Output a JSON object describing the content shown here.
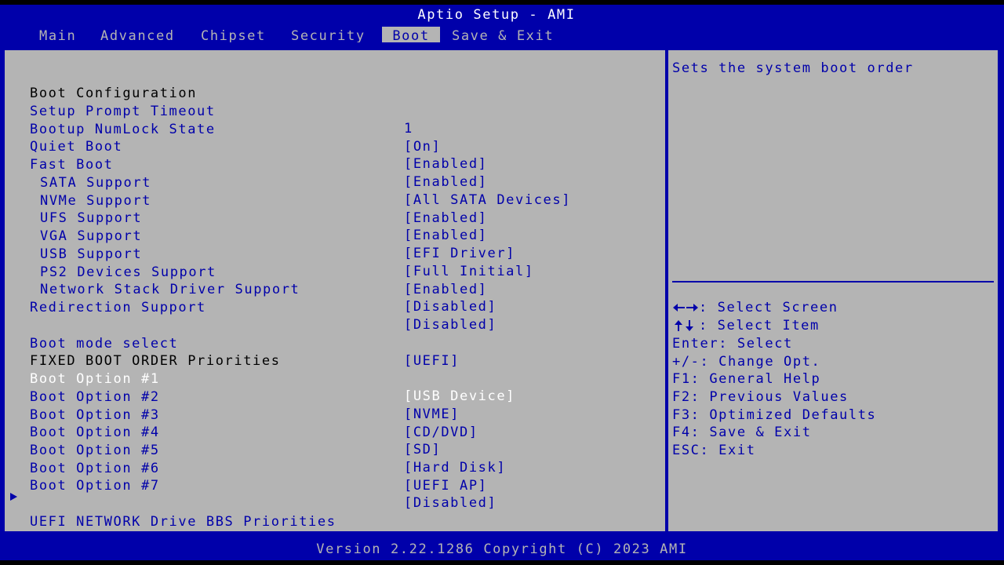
{
  "app": {
    "title": "Aptio Setup - AMI"
  },
  "tabs": [
    {
      "label": "Main"
    },
    {
      "label": "Advanced"
    },
    {
      "label": "Chipset"
    },
    {
      "label": "Security"
    },
    {
      "label": "Boot",
      "active": true
    },
    {
      "label": "Save & Exit"
    }
  ],
  "boot": {
    "section_title": "Boot Configuration",
    "settings": [
      {
        "label": "Setup Prompt Timeout",
        "value": "1"
      },
      {
        "label": "Bootup NumLock State",
        "value": "[On]"
      },
      {
        "label": "Quiet Boot",
        "value": "[Enabled]"
      },
      {
        "label": "Fast Boot",
        "value": "[Enabled]"
      },
      {
        "label": "SATA Support",
        "value": "[All SATA Devices]"
      },
      {
        "label": "NVMe Support",
        "value": "[Enabled]"
      },
      {
        "label": "UFS Support",
        "value": "[Enabled]"
      },
      {
        "label": "VGA Support",
        "value": "[EFI Driver]"
      },
      {
        "label": "USB Support",
        "value": "[Full Initial]"
      },
      {
        "label": "PS2 Devices Support",
        "value": "[Enabled]"
      },
      {
        "label": "Network Stack Driver Support",
        "value": "[Disabled]"
      },
      {
        "label": "Redirection Support",
        "value": "[Disabled]"
      }
    ],
    "boot_mode": {
      "label": "Boot mode select",
      "value": "[UEFI]"
    },
    "priorities_title": "FIXED BOOT ORDER Priorities",
    "boot_options": [
      {
        "label": "Boot Option #1",
        "value": "[USB Device]",
        "selected": true
      },
      {
        "label": "Boot Option #2",
        "value": "[NVME]"
      },
      {
        "label": "Boot Option #3",
        "value": "[CD/DVD]"
      },
      {
        "label": "Boot Option #4",
        "value": "[SD]"
      },
      {
        "label": "Boot Option #5",
        "value": "[Hard Disk]"
      },
      {
        "label": "Boot Option #6",
        "value": "[UEFI AP]"
      },
      {
        "label": "Boot Option #7",
        "value": "[Disabled]"
      }
    ],
    "submenu": {
      "label": "UEFI NETWORK Drive BBS Priorities"
    }
  },
  "help": {
    "text": "Sets the system boot order",
    "keys": [
      {
        "key": "",
        "icon": "left-right-arrows-icon",
        "desc": ": Select Screen"
      },
      {
        "key": "",
        "icon": "up-down-arrows-icon",
        "desc": ": Select Item"
      },
      {
        "key": "Enter",
        "desc": ": Select"
      },
      {
        "key": "+/-",
        "desc": ": Change Opt."
      },
      {
        "key": "F1",
        "desc": ": General Help"
      },
      {
        "key": "F2",
        "desc": ": Previous Values"
      },
      {
        "key": "F3",
        "desc": ": Optimized Defaults"
      },
      {
        "key": "F4",
        "desc": ": Save & Exit"
      },
      {
        "key": "ESC",
        "desc": ": Exit"
      }
    ]
  },
  "footer": {
    "text": "Version 2.22.1286 Copyright (C) 2023 AMI"
  },
  "colors": {
    "frame_blue": "#0000aa",
    "panel_gray": "#b4b4b4",
    "selected_text": "#ffffff",
    "static_text": "#000000"
  }
}
